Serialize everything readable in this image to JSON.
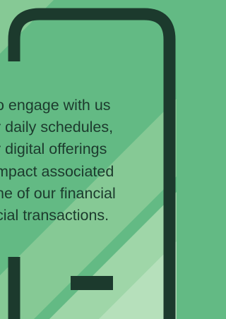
{
  "colors": {
    "background": "#63ba84",
    "light_panel": "#9fd6a8",
    "outline": "#1c3a2d",
    "text": "#1c3a2d"
  },
  "phone": {
    "icon": "smartphone-outline-icon"
  },
  "body_text": {
    "lines": [
      "o engage with us",
      "r daily schedules,",
      "r digital offerings",
      "mpact associated",
      "ne of our financial",
      "cial transactions."
    ]
  }
}
